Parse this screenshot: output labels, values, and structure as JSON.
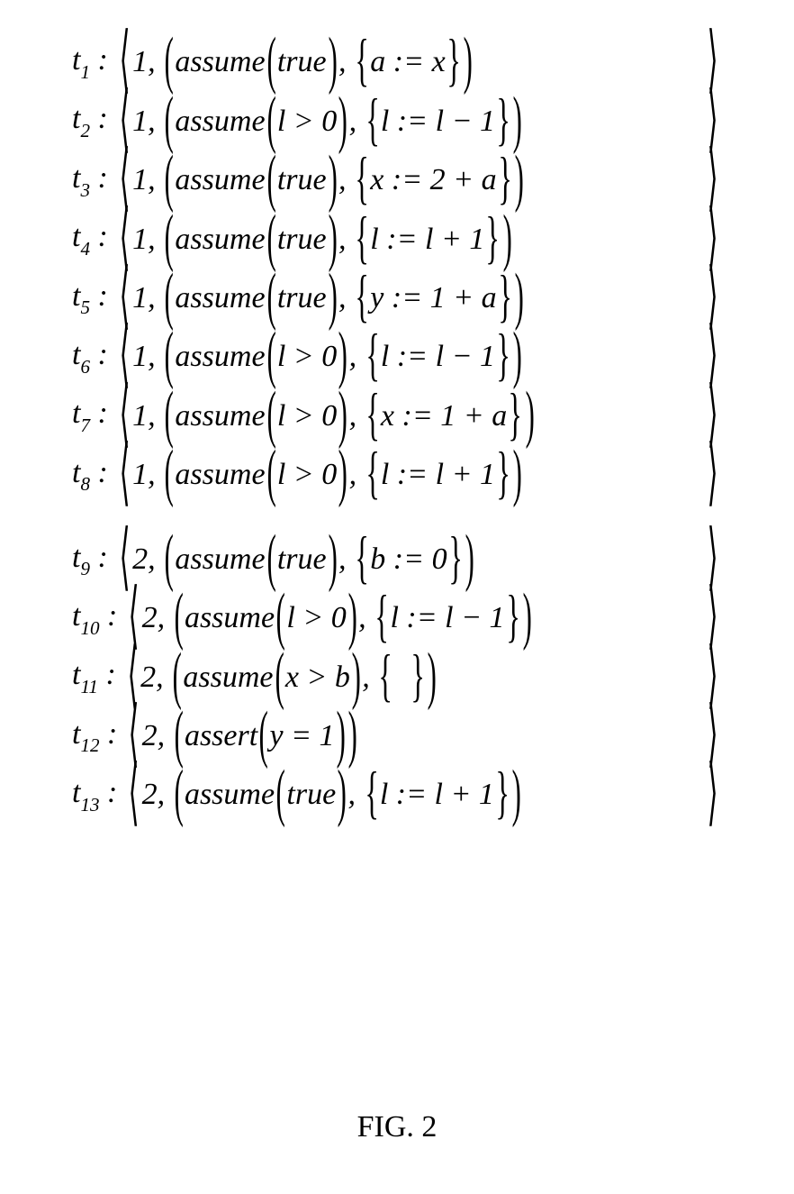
{
  "caption": "FIG. 2",
  "groups": [
    {
      "rows": [
        {
          "label_sub": "1",
          "thread": "1",
          "func": "assume",
          "cond": "true",
          "action": "a := x",
          "empty": false,
          "has_action": true
        },
        {
          "label_sub": "2",
          "thread": "1",
          "func": "assume",
          "cond": "l > 0",
          "action": "l := l − 1",
          "empty": false,
          "has_action": true
        },
        {
          "label_sub": "3",
          "thread": "1",
          "func": "assume",
          "cond": "true",
          "action": "x := 2 + a",
          "empty": false,
          "has_action": true
        },
        {
          "label_sub": "4",
          "thread": "1",
          "func": "assume",
          "cond": "true",
          "action": "l := l + 1",
          "empty": false,
          "has_action": true
        },
        {
          "label_sub": "5",
          "thread": "1",
          "func": "assume",
          "cond": "true",
          "action": "y := 1 + a",
          "empty": false,
          "has_action": true
        },
        {
          "label_sub": "6",
          "thread": "1",
          "func": "assume",
          "cond": "l > 0",
          "action": "l := l − 1",
          "empty": false,
          "has_action": true
        },
        {
          "label_sub": "7",
          "thread": "1",
          "func": "assume",
          "cond": "l > 0",
          "action": "x := 1 + a",
          "empty": false,
          "has_action": true
        },
        {
          "label_sub": "8",
          "thread": "1",
          "func": "assume",
          "cond": "l > 0",
          "action": "l := l + 1",
          "empty": false,
          "has_action": true
        }
      ]
    },
    {
      "rows": [
        {
          "label_sub": "9",
          "thread": "2",
          "func": "assume",
          "cond": "true",
          "action": "b := 0",
          "empty": false,
          "has_action": true
        },
        {
          "label_sub": "10",
          "thread": "2",
          "func": "assume",
          "cond": "l > 0",
          "action": "l := l − 1",
          "empty": false,
          "has_action": true
        },
        {
          "label_sub": "11",
          "thread": "2",
          "func": "assume",
          "cond": "x > b",
          "action": "",
          "empty": true,
          "has_action": true
        },
        {
          "label_sub": "12",
          "thread": "2",
          "func": "assert",
          "cond": "y = 1",
          "action": "",
          "empty": false,
          "has_action": false
        },
        {
          "label_sub": "13",
          "thread": "2",
          "func": "assume",
          "cond": "true",
          "action": "l := l + 1",
          "empty": false,
          "has_action": true
        }
      ]
    }
  ]
}
